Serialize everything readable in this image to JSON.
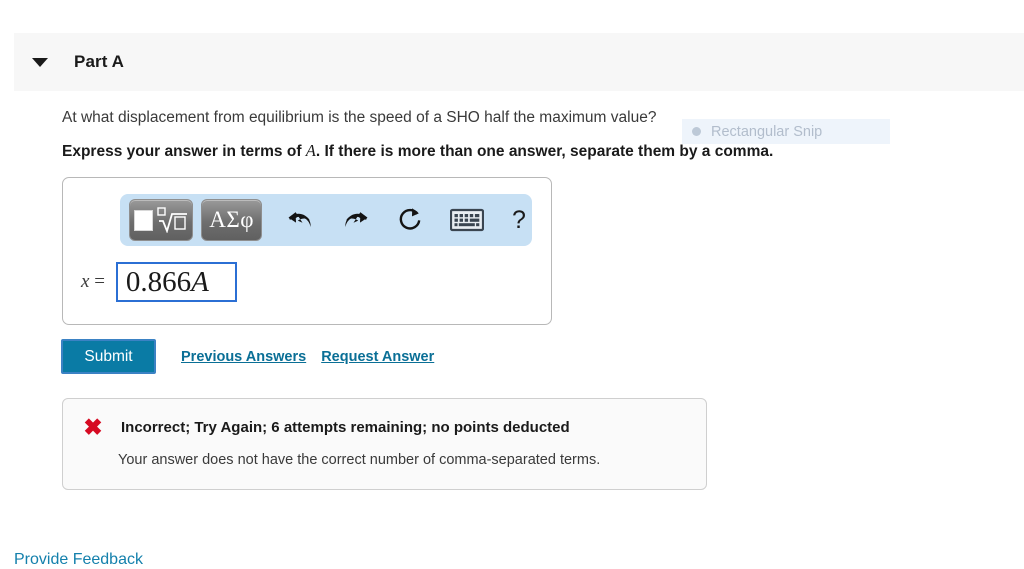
{
  "part": {
    "title": "Part A",
    "disclosure_icon": "triangle-down-icon",
    "expanded": true
  },
  "question": {
    "prompt": "At what displacement from equilibrium is the speed of a SHO half the maximum value?",
    "instruction_before": "Express your answer in terms of ",
    "instruction_variable": "A",
    "instruction_after": ". If there is more than one answer, separate them by a comma."
  },
  "overlay": {
    "tooltip_label": "Rectangular Snip"
  },
  "answer_entry": {
    "toolbar": {
      "buttons": [
        {
          "name": "math-template-button",
          "icon": "square-and-nth-root-icon",
          "label": ""
        },
        {
          "name": "greek-symbols-button",
          "icon": "greek-letters-icon",
          "label": "ΑΣφ"
        },
        {
          "name": "undo-button",
          "icon": "undo-arrow-icon",
          "label": ""
        },
        {
          "name": "redo-button",
          "icon": "redo-arrow-icon",
          "label": ""
        },
        {
          "name": "reset-button",
          "icon": "circular-refresh-icon",
          "label": ""
        },
        {
          "name": "keyboard-button",
          "icon": "keyboard-icon",
          "label": ""
        },
        {
          "name": "help-button",
          "icon": "question-mark-icon",
          "label": "?"
        }
      ],
      "background_color": "#c7e0f4"
    },
    "field_label_variable": "x",
    "field_label_equals": " = ",
    "field_value_number": "0.866",
    "field_value_variable": "A",
    "field_focus_color": "#2b6fd4"
  },
  "actions": {
    "submit_label": "Submit",
    "submit_color": "#0a7ba5",
    "previous_answers_label": "Previous Answers",
    "request_answer_label": "Request Answer",
    "link_color": "#0a6f96"
  },
  "feedback": {
    "status_icon": "x-mark-icon",
    "status_color": "#d60a22",
    "title": "Incorrect; Try Again; 6 attempts remaining; no points deducted",
    "detail": "Your answer does not have the correct number of comma-separated terms.",
    "attempts_remaining": 6
  },
  "footer": {
    "provide_feedback_label": "Provide Feedback",
    "link_color": "#1480ac"
  }
}
